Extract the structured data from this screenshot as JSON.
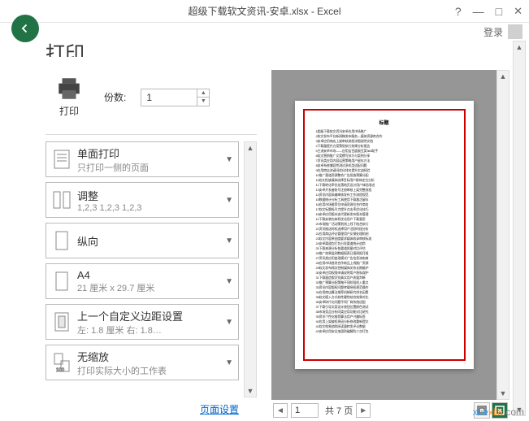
{
  "titlebar": {
    "title": "超级下载软文资讯-安卓.xlsx - Excel",
    "login": "登录",
    "help": "?",
    "minimize": "—",
    "maximize": "□",
    "close": "✕"
  },
  "page": {
    "title": "打印"
  },
  "print": {
    "label": "打印",
    "copies_label": "份数:",
    "copies_value": "1"
  },
  "options": [
    {
      "title": "单面打印",
      "sub": "只打印一侧的页面"
    },
    {
      "title": "调整",
      "sub": "1,2,3    1,2,3    1,2,3"
    },
    {
      "title": "纵向",
      "sub": ""
    },
    {
      "title": "A4",
      "sub": "21 厘米 x 29.7 厘米"
    },
    {
      "title": "上一个自定义边距设置",
      "sub": "左: 1.8 厘米    右: 1.8…"
    },
    {
      "title": "无缩放",
      "sub": "打印实际大小的工作表"
    }
  ],
  "page_setup_link": "页面设置",
  "pager": {
    "prev": "◄",
    "next": "►",
    "current": "1",
    "total_label": "共 7 页"
  },
  "preview": {
    "heading": "标题"
  },
  "watermark": {
    "x": "xue",
    "cn": "xila",
    "com": ".com"
  }
}
